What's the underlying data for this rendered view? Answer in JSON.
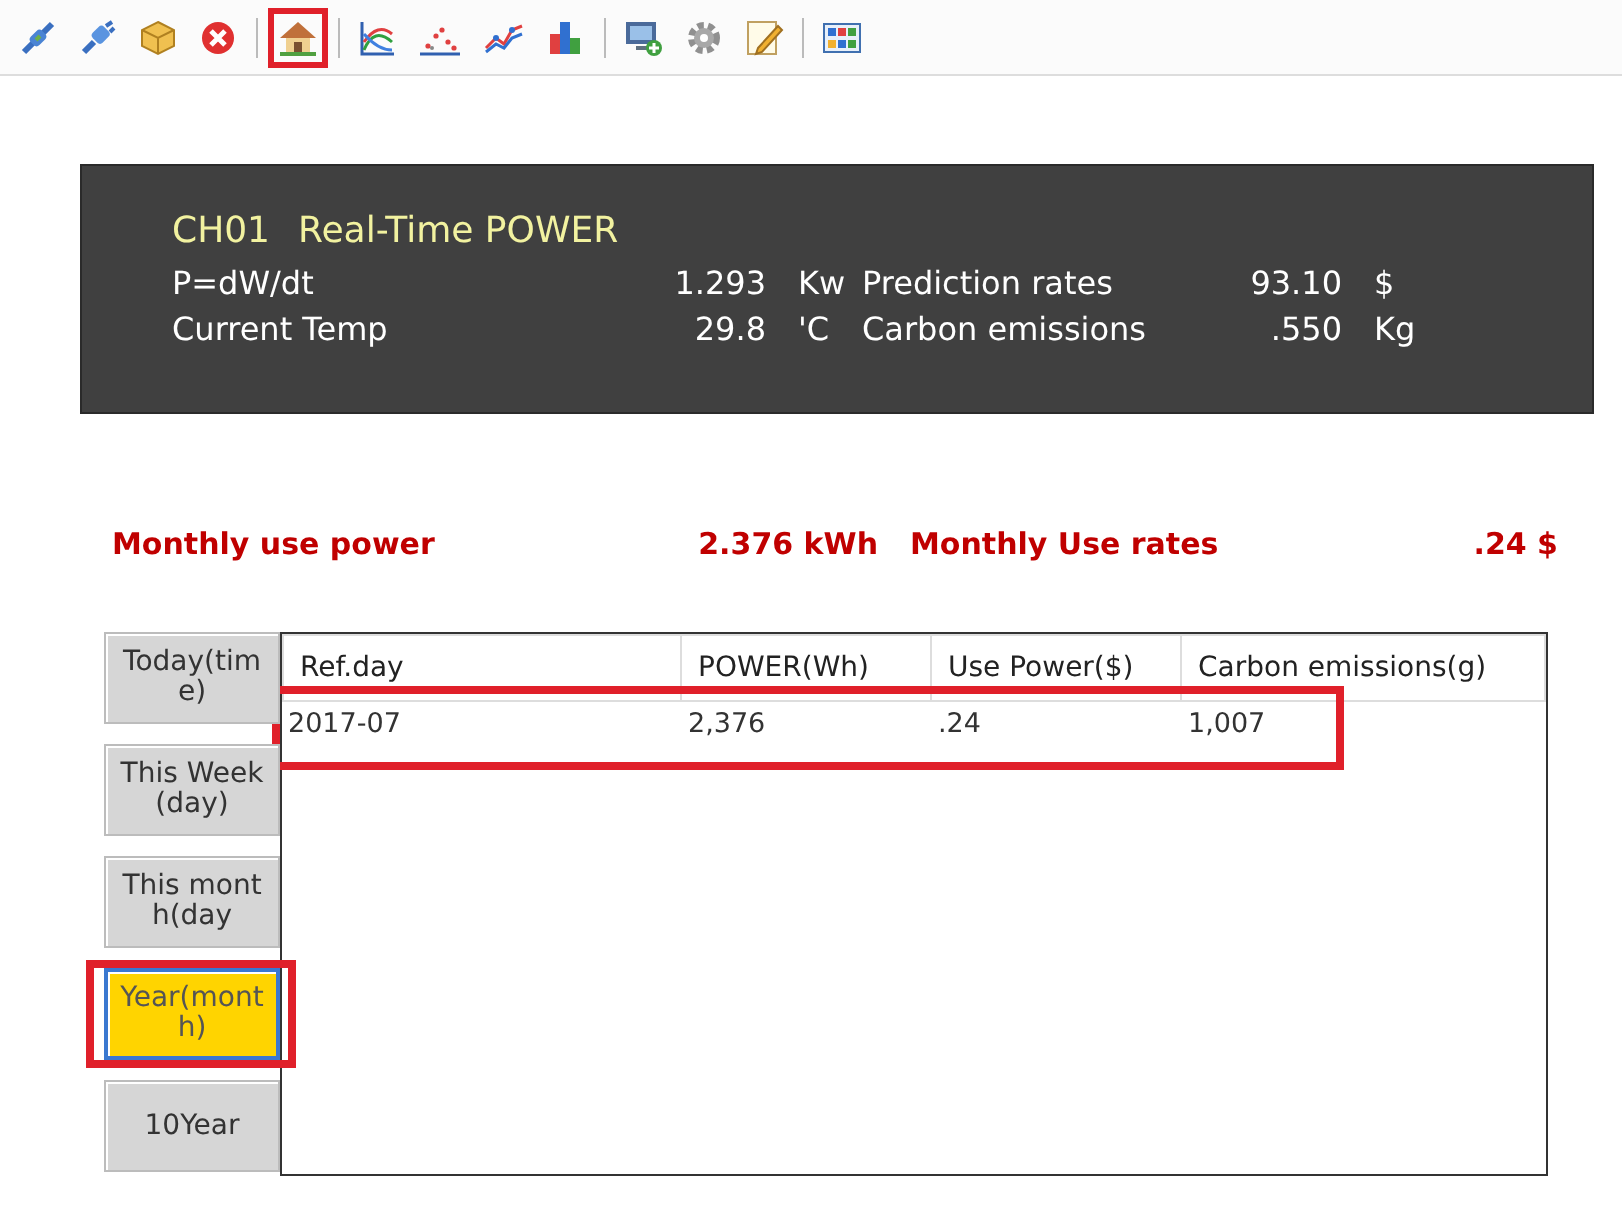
{
  "toolbar": {
    "groups": [
      [
        {
          "kind": "plug",
          "selected": false
        },
        {
          "kind": "plug-alt",
          "selected": false
        },
        {
          "kind": "box",
          "selected": false
        },
        {
          "kind": "close",
          "selected": false
        }
      ],
      [
        {
          "kind": "home",
          "selected": true
        }
      ],
      [
        {
          "kind": "area-chart",
          "selected": false
        },
        {
          "kind": "scatter-chart",
          "selected": false
        },
        {
          "kind": "line-chart",
          "selected": false
        },
        {
          "kind": "bar-chart",
          "selected": false
        }
      ],
      [
        {
          "kind": "monitor",
          "selected": false
        },
        {
          "kind": "gear",
          "selected": false
        },
        {
          "kind": "pencil",
          "selected": false
        }
      ],
      [
        {
          "kind": "grid",
          "selected": false
        }
      ]
    ]
  },
  "realtime": {
    "channel": "CH01",
    "title": "Real-Time POWER",
    "readings": [
      {
        "label": "P=dW/dt",
        "value": "1.293",
        "unit": "Kw"
      },
      {
        "label": "Prediction rates",
        "value": "93.10",
        "unit": "$"
      },
      {
        "label": "Current Temp",
        "value": "29.8",
        "unit": "'C"
      },
      {
        "label": "Carbon emissions",
        "value": ".550",
        "unit": "Kg"
      }
    ]
  },
  "monthly": [
    {
      "label": "Monthly use power",
      "value": "2.376 kWh"
    },
    {
      "label": "Monthly Use rates",
      "value": ".24 $"
    }
  ],
  "periods": [
    {
      "label": "Today(time)",
      "selected": false,
      "highlighted": false
    },
    {
      "label": "This Week(day)",
      "selected": false,
      "highlighted": false
    },
    {
      "label": "This month(day",
      "selected": false,
      "highlighted": false
    },
    {
      "label": "Year(month)",
      "selected": true,
      "highlighted": true
    },
    {
      "label": "10Year",
      "selected": false,
      "highlighted": false
    }
  ],
  "table": {
    "columns": [
      "Ref.day",
      "POWER(Wh)",
      "Use Power($)",
      "Carbon emissions(g)"
    ],
    "rows": [
      {
        "cells": [
          "2017-07",
          "2,376",
          ".24",
          "1,007"
        ],
        "highlighted": true
      }
    ]
  }
}
